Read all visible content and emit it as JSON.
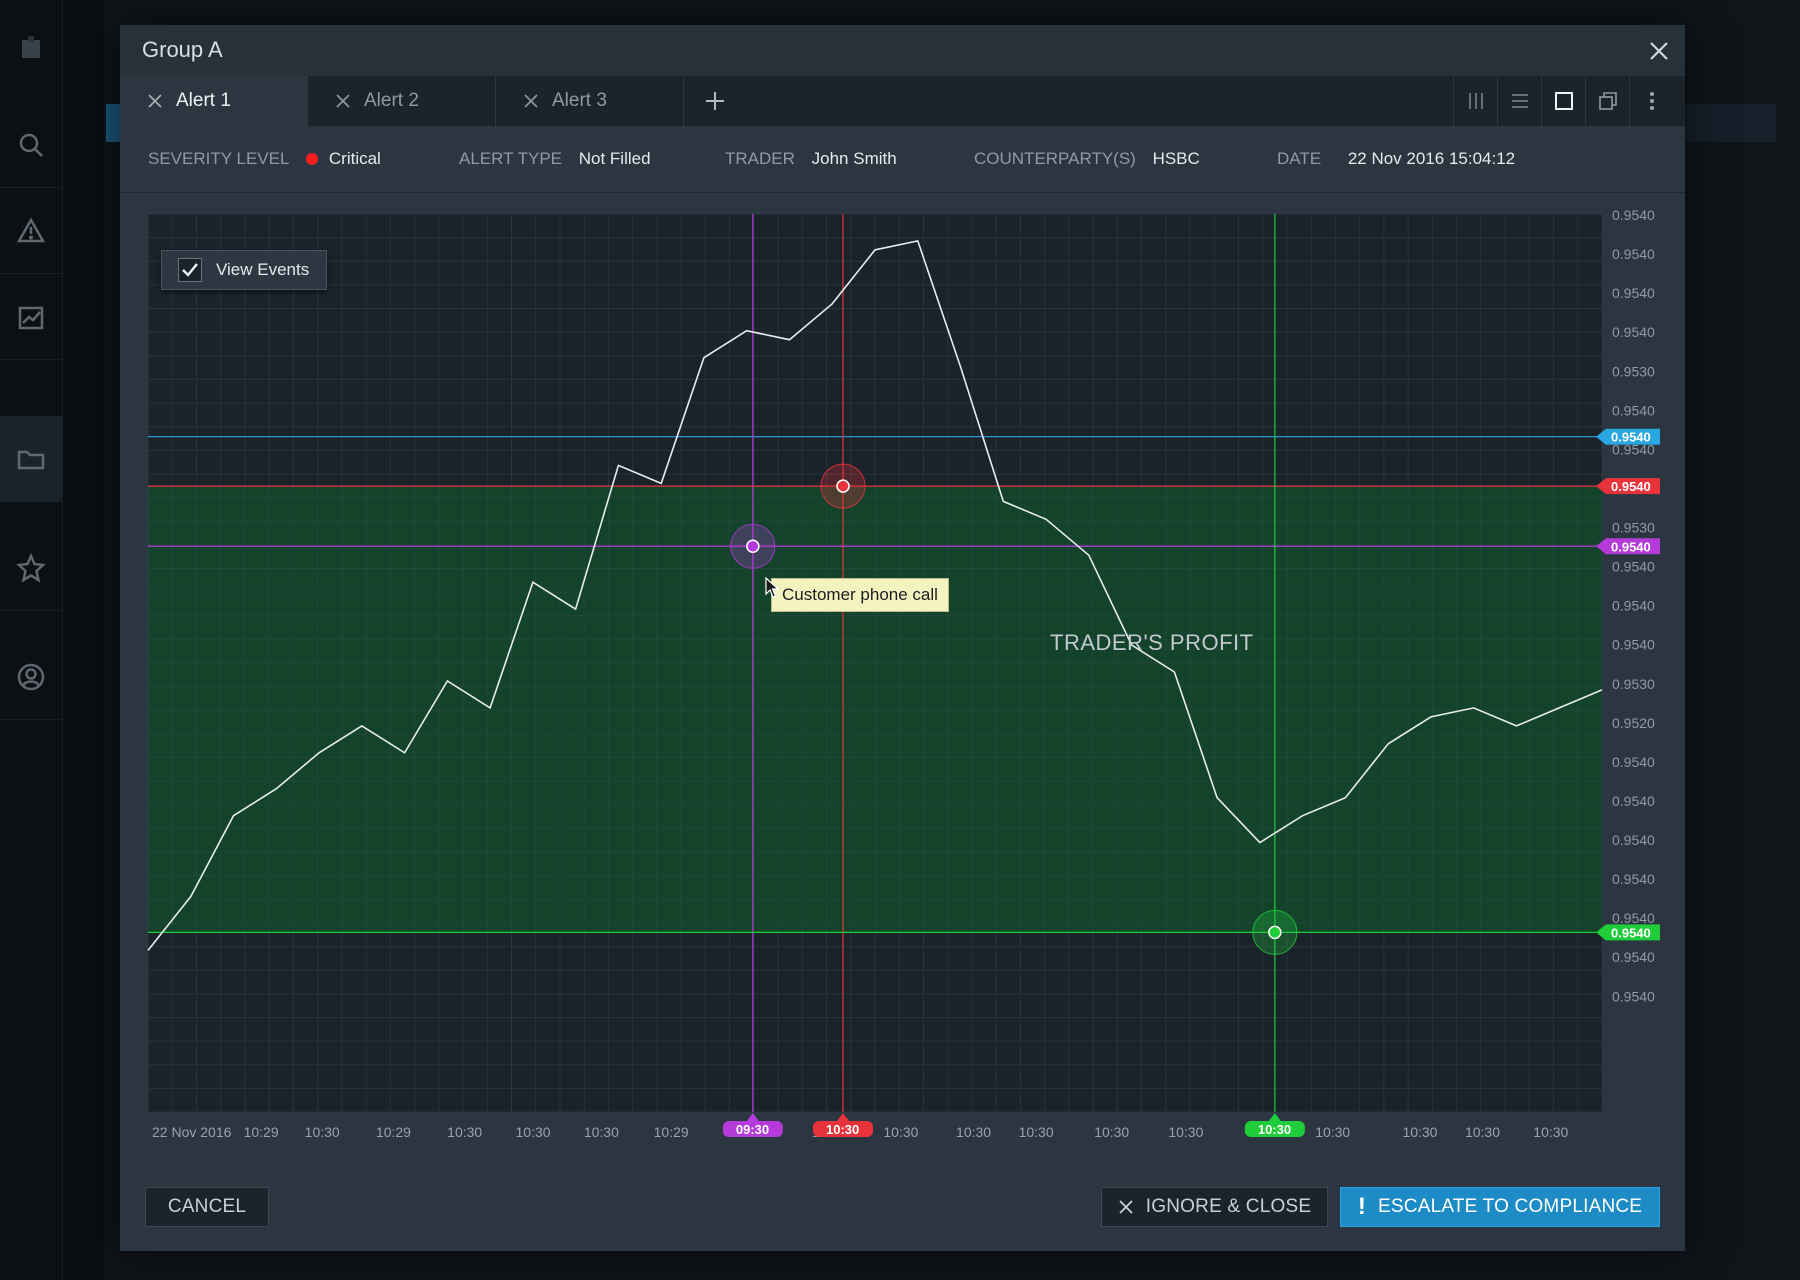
{
  "modal": {
    "title": "Group A"
  },
  "tabs": [
    {
      "label": "Alert 1",
      "active": true
    },
    {
      "label": "Alert 2",
      "active": false
    },
    {
      "label": "Alert 3",
      "active": false
    }
  ],
  "layout_buttons": [
    "columns-icon",
    "rows-icon",
    "single-view-icon",
    "detach-icon",
    "more-vertical-icon"
  ],
  "info": {
    "severity_label": "SEVERITY LEVEL",
    "severity_value": "Critical",
    "alert_type_label": "ALERT TYPE",
    "alert_type_value": "Not Filled",
    "trader_label": "TRADER",
    "trader_value": "John Smith",
    "counterparty_label": "COUNTERPARTY(S)",
    "counterparty_value": "HSBC",
    "date_label": "DATE",
    "date_value": "22 Nov 2016 15:04:12"
  },
  "view_events": {
    "label": "View Events",
    "checked": true
  },
  "tooltip": "Customer phone call",
  "profit_label": "TRADER'S PROFIT",
  "buttons": {
    "cancel": "CANCEL",
    "ignore": "IGNORE & CLOSE",
    "escalate": "ESCALATE TO COMPLIANCE"
  },
  "colors": {
    "critical": "#ff1e1e",
    "accent": "#1c8bc6",
    "event_purple": "#b43bd9",
    "event_red": "#e8333b",
    "event_green": "#1fcc3a",
    "reference_blue": "#2aa7e0",
    "profit_fill": "#13472b"
  },
  "chart_data": {
    "type": "line",
    "x_tick_labels": [
      "22 Nov 2016",
      "10:29",
      "10:30",
      "10:29",
      "10:30",
      "10:30",
      "10:30",
      "10:29",
      "09:30",
      "10:30",
      "10:30",
      "10:30",
      "10:30",
      "10:30",
      "10:30",
      "10:30",
      "10:30",
      "10:30",
      "10:30",
      "10:30"
    ],
    "y_tick_labels": [
      "0.9540",
      "0.9540",
      "0.9540",
      "0.9540",
      "0.9530",
      "0.9540",
      "0.9540",
      "0.9540",
      "0.9530",
      "0.9540",
      "0.9540",
      "0.9540",
      "0.9530",
      "0.9520",
      "0.9540",
      "0.9540",
      "0.9540",
      "0.9540",
      "0.9540",
      "0.9540",
      "0.9540"
    ],
    "series": [
      {
        "values": [
          0.18,
          0.24,
          0.33,
          0.36,
          0.4,
          0.43,
          0.4,
          0.48,
          0.45,
          0.59,
          0.56,
          0.72,
          0.7,
          0.84,
          0.87,
          0.86,
          0.9,
          0.96,
          0.97,
          0.83,
          0.68,
          0.66,
          0.62,
          0.52,
          0.49,
          0.35,
          0.3,
          0.33,
          0.35,
          0.41,
          0.44,
          0.45,
          0.43,
          0.45,
          0.47
        ]
      }
    ],
    "events": [
      {
        "label": "09:30",
        "color": "#b43bd9",
        "level_label": "0.9540",
        "tooltip": "Customer phone call"
      },
      {
        "label": "10:30",
        "color": "#e8333b",
        "level_label": "0.9540"
      },
      {
        "label": "10:30",
        "color": "#1fcc3a",
        "level_label": "0.9540"
      }
    ],
    "reference_lines": [
      {
        "label": "0.9540",
        "color": "#2aa7e0"
      }
    ],
    "shaded_region": {
      "label": "TRADER'S PROFIT",
      "color": "#13472b"
    },
    "grid": true
  }
}
